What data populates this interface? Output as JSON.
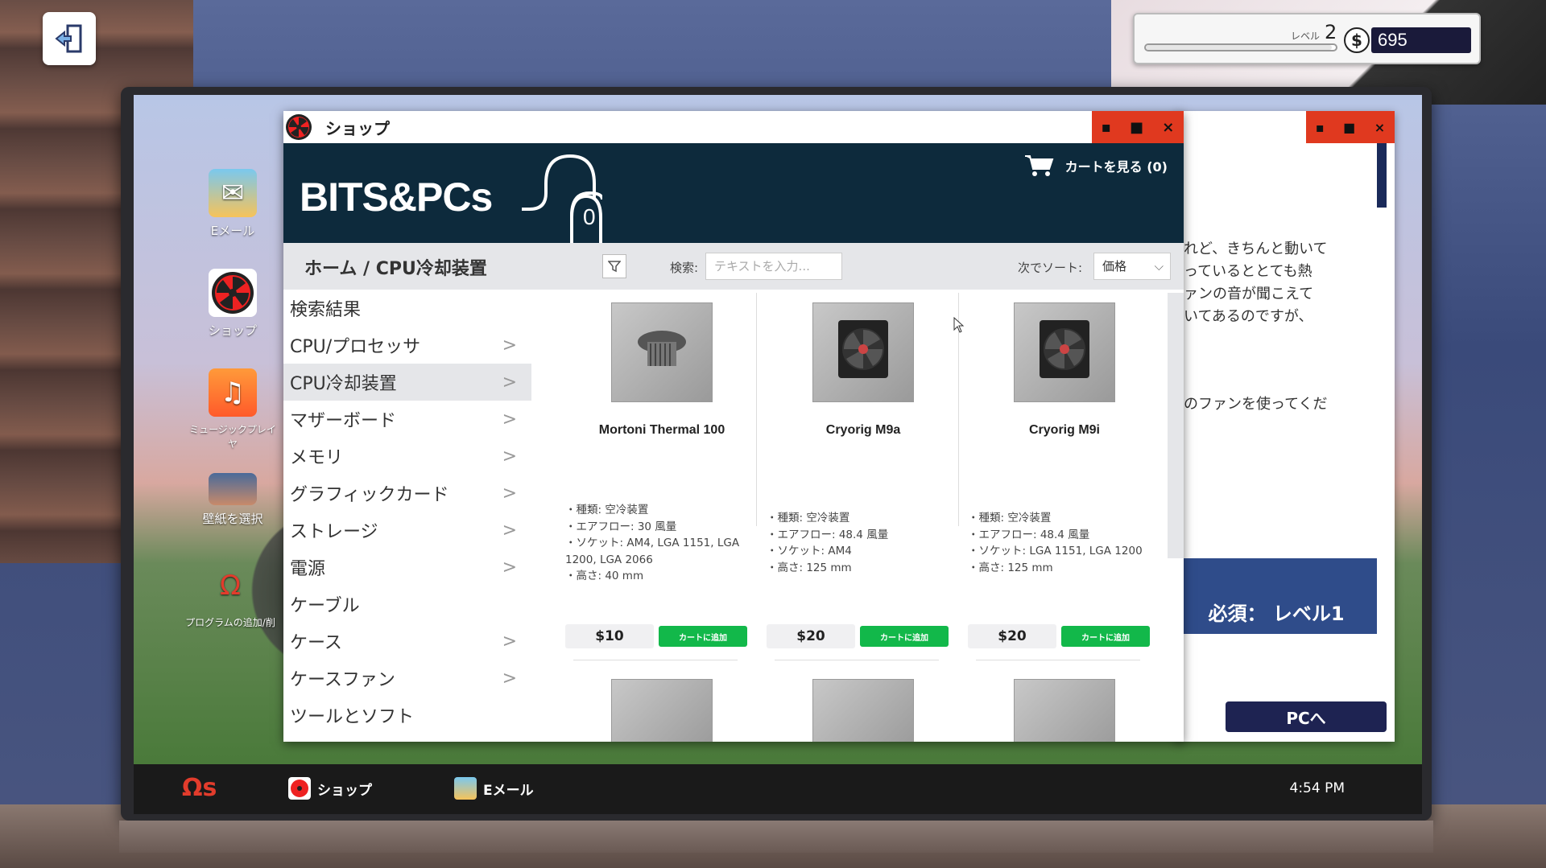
{
  "hud": {
    "level_label": "レベル",
    "level": "2",
    "currency_symbol": "$",
    "money": "695",
    "xp_fill_fraction": 0.98
  },
  "desktop": {
    "icons": [
      {
        "label": "Eメール",
        "icon": "email-icon"
      },
      {
        "label": "ショップ",
        "icon": "shop-fan-icon"
      },
      {
        "label": "ミュージックプレイヤ",
        "icon": "music-note-icon"
      },
      {
        "label": "壁紙を選択",
        "icon": "wallpaper-icon"
      },
      {
        "label": "プログラムの追加/削",
        "icon": "omega-icon"
      }
    ]
  },
  "taskbar": {
    "logo": "Ωs",
    "items": [
      {
        "label": "ショップ"
      },
      {
        "label": "Eメール"
      }
    ],
    "clock": "4:54 PM"
  },
  "email_window": {
    "body_lines": "れど、きちんと動いて\nっているととても熱\nァンの音が聞こえて\nいてあるのですが、",
    "body_line2": "のファンを使ってくだ",
    "requirement": "必須： レベル1",
    "pc_button": "PCへ"
  },
  "shop_window": {
    "title": "ショップ",
    "logo": "BITS&PCs",
    "badge_count": "0",
    "cart_label": "カートを見る (0)",
    "breadcrumb": "ホーム / CPU冷却装置",
    "search_label": "検索:",
    "search_placeholder": "テキストを入力...",
    "sort_label": "次でソート:",
    "sort_value": "価格",
    "categories": [
      {
        "label": "検索結果",
        "arrow": ""
      },
      {
        "label": "CPU/プロセッサ",
        "arrow": ">"
      },
      {
        "label": "CPU冷却装置",
        "arrow": ">"
      },
      {
        "label": "マザーボード",
        "arrow": ">"
      },
      {
        "label": "メモリ",
        "arrow": ">"
      },
      {
        "label": "グラフィックカード",
        "arrow": ">"
      },
      {
        "label": "ストレージ",
        "arrow": ">"
      },
      {
        "label": "電源",
        "arrow": ">"
      },
      {
        "label": "ケーブル",
        "arrow": ""
      },
      {
        "label": "ケース",
        "arrow": ">"
      },
      {
        "label": "ケースファン",
        "arrow": ">"
      },
      {
        "label": "ツールとソフト",
        "arrow": ""
      }
    ],
    "products": [
      {
        "name": "Mortoni Thermal 100",
        "specs": [
          "・種類: 空冷装置",
          "・エアフロー: 30 風量",
          "・ソケット: AM4, LGA 1151, LGA 1200, LGA 2066",
          "・高さ: 40 mm"
        ],
        "price": "$10",
        "add_label": "カートに追加"
      },
      {
        "name": "Cryorig M9a",
        "specs": [
          "・種類: 空冷装置",
          "・エアフロー: 48.4 風量",
          "・ソケット: AM4",
          "・高さ: 125 mm"
        ],
        "price": "$20",
        "add_label": "カートに追加"
      },
      {
        "name": "Cryorig M9i",
        "specs": [
          "・種類: 空冷装置",
          "・エアフロー: 48.4 風量",
          "・ソケット: LGA 1151, LGA 1200",
          "・高さ: 125 mm"
        ],
        "price": "$20",
        "add_label": "カートに追加"
      }
    ]
  },
  "window_controls": {
    "minimize": "▪",
    "maximize": "■",
    "close": "×"
  }
}
